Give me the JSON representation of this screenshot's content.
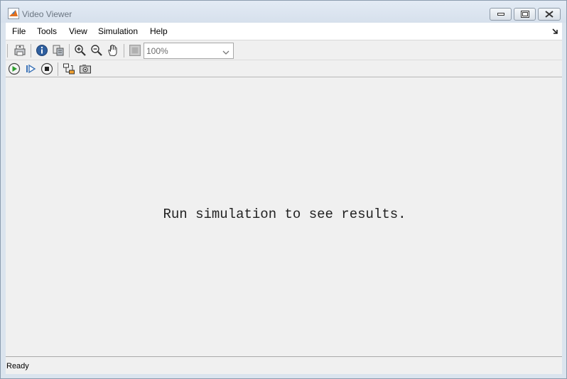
{
  "window": {
    "title": "Video Viewer"
  },
  "menu": {
    "items": [
      {
        "label": "File"
      },
      {
        "label": "Tools"
      },
      {
        "label": "View"
      },
      {
        "label": "Simulation"
      },
      {
        "label": "Help"
      }
    ]
  },
  "toolbar": {
    "icons": [
      "print-icon",
      "info-icon",
      "properties-icon",
      "zoom-in-icon",
      "zoom-out-icon",
      "pan-icon",
      "fit-to-view-icon"
    ],
    "zoom": {
      "value": "100%"
    }
  },
  "sim_toolbar": {
    "icons": [
      "run-icon",
      "step-forward-icon",
      "stop-icon",
      "highlight-block-icon",
      "snapshot-icon"
    ]
  },
  "display": {
    "message": "Run simulation to see results."
  },
  "status": {
    "text": "Ready"
  },
  "colors": {
    "run_green": "#2e9e2e",
    "step_blue": "#3d74b8",
    "frame": "#dbe4ee",
    "client_bg": "#f0f0f0"
  }
}
